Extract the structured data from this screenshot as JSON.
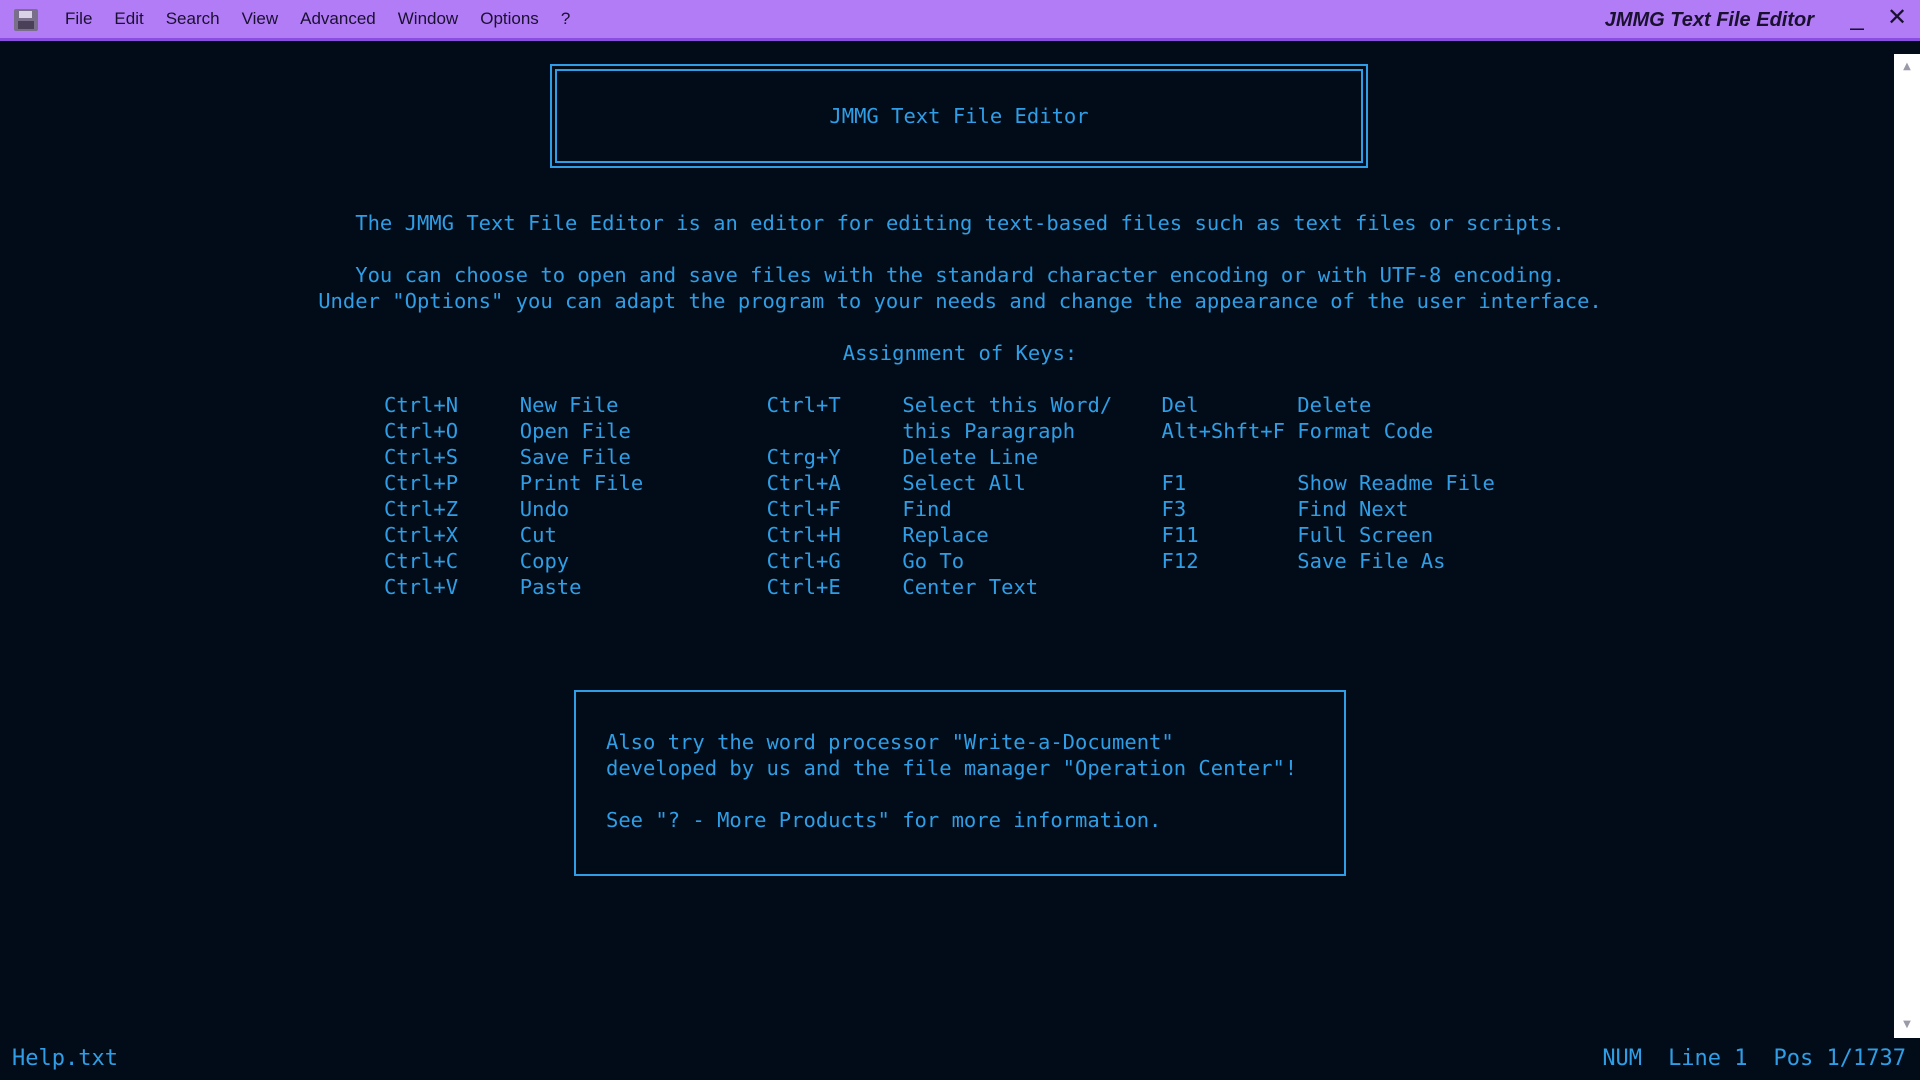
{
  "window": {
    "title": "JMMG Text File Editor",
    "minimize_symbol": "_",
    "close_symbol": "✕"
  },
  "menu": [
    "File",
    "Edit",
    "Search",
    "View",
    "Advanced",
    "Window",
    "Options",
    "?"
  ],
  "document": {
    "header_title": "JMMG Text File Editor",
    "intro": "The JMMG Text File Editor is an editor for editing text-based files such as text files or scripts.",
    "encoding_line": "You can choose to open and save files with the standard character encoding or with UTF-8 encoding.",
    "options_line": "Under \"Options\" you can adapt the program to your needs and change the appearance of the user interface.",
    "keys_heading": "Assignment of Keys:",
    "key_lines": [
      "Ctrl+N     New File            Ctrl+T     Select this Word/    Del        Delete",
      "Ctrl+O     Open File                      this Paragraph       Alt+Shft+F Format Code",
      "Ctrl+S     Save File           Ctrg+Y     Delete Line",
      "Ctrl+P     Print File          Ctrl+A     Select All           F1         Show Readme File",
      "Ctrl+Z     Undo                Ctrl+F     Find                 F3         Find Next",
      "Ctrl+X     Cut                 Ctrl+H     Replace              F11        Full Screen",
      "Ctrl+C     Copy                Ctrl+G     Go To                F12        Save File As",
      "Ctrl+V     Paste               Ctrl+E     Center Text"
    ],
    "promo_lines": [
      "Also try the word processor \"Write-a-Document\"",
      "developed by us and the file manager \"Operation Center\"!",
      "",
      "See \"? - More Products\" for more information."
    ]
  },
  "status": {
    "filename": "Help.txt",
    "num": "NUM",
    "line": "Line 1",
    "pos": "Pos 1/1737"
  },
  "colors": {
    "background": "#020c18",
    "text": "#2f9ee6",
    "titlebar": "#b27cf6"
  }
}
